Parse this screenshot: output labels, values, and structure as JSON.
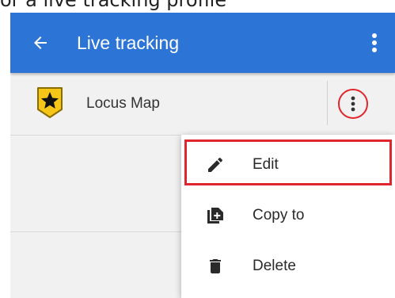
{
  "caption": "or a live tracking profile",
  "appbar": {
    "title": "Live tracking",
    "back_icon": "arrow-left-icon",
    "more_icon": "more-vertical-icon",
    "color": "#2c74d6"
  },
  "list": {
    "items": [
      {
        "label": "Locus Map",
        "icon": "star-pin-icon"
      }
    ]
  },
  "menu": {
    "items": [
      {
        "label": "Edit",
        "icon": "pencil-icon"
      },
      {
        "label": "Copy to",
        "icon": "copy-add-icon"
      },
      {
        "label": "Delete",
        "icon": "trash-icon"
      }
    ]
  },
  "colors": {
    "highlight": "#e0262c",
    "icon_yellow": "#f5c518"
  }
}
